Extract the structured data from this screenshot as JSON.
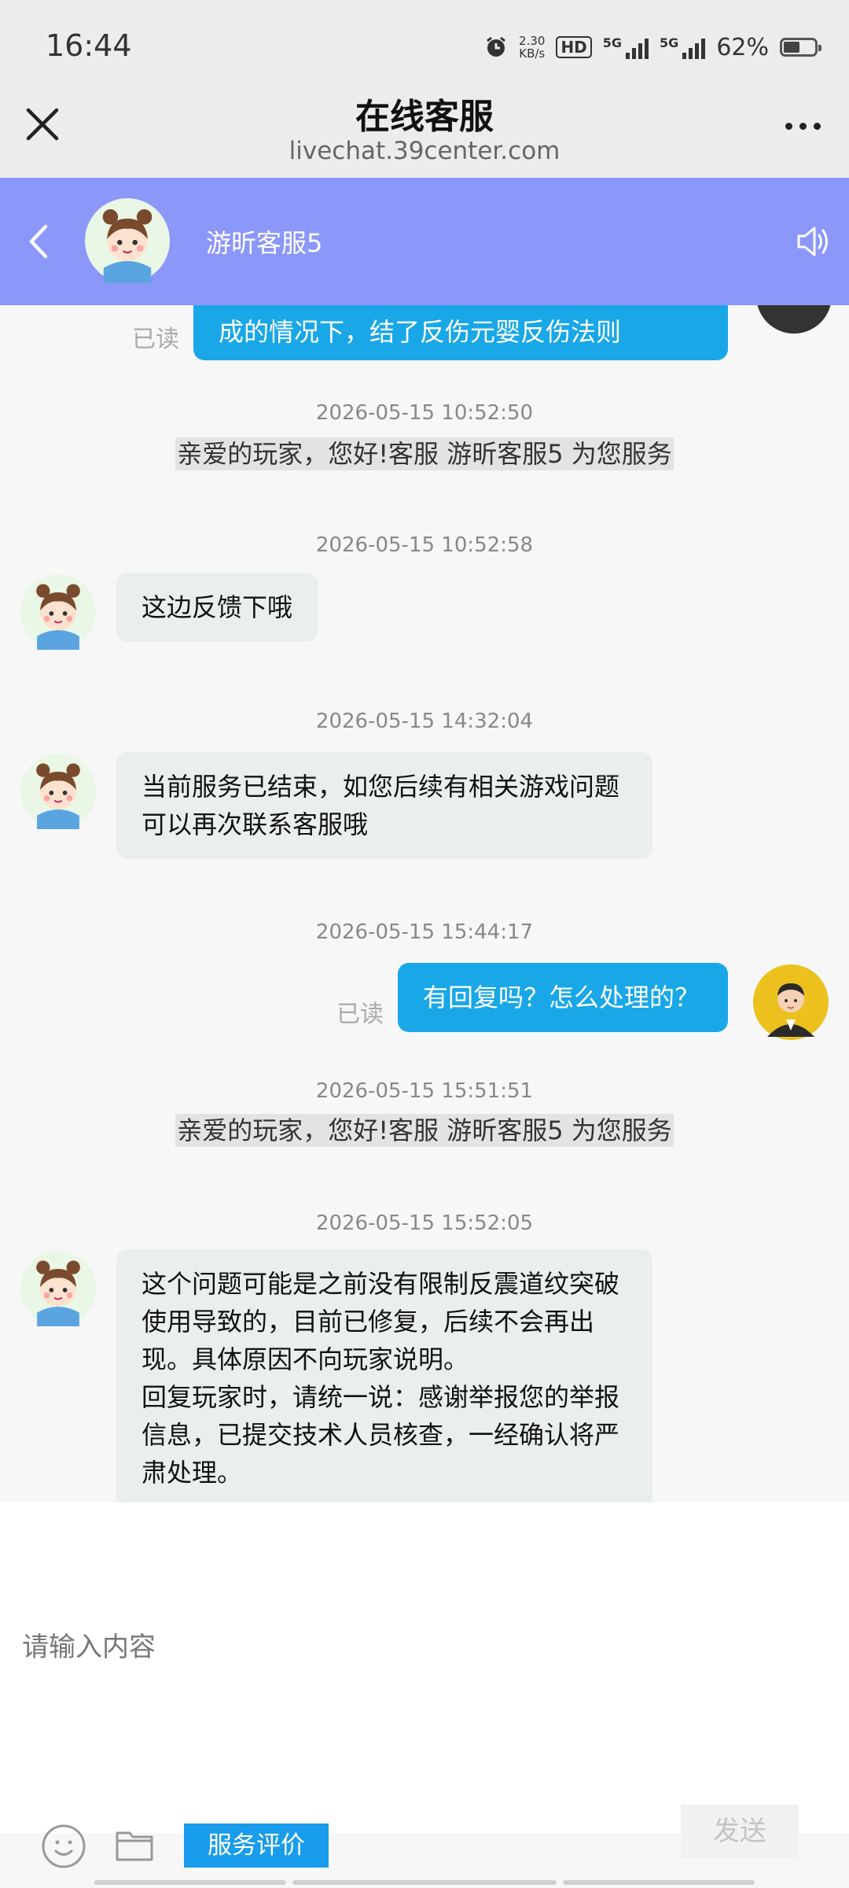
{
  "status_bar": {
    "time": "16:44",
    "net_speed_value": "2.30",
    "net_speed_unit": "KB/s",
    "hd": "HD",
    "signal1": "5G",
    "signal2": "5G",
    "battery": "62%"
  },
  "browser": {
    "title": "在线客服",
    "url": "livechat.39center.com"
  },
  "chat_header": {
    "agent_name": "游昕客服5"
  },
  "messages": {
    "top_partial": {
      "text": "成的情况下，结了反伤元婴反伤法则",
      "read": "已读"
    },
    "ts1": "2026-05-15 10:52:50",
    "notice1": "亲爱的玩家，您好!客服 游昕客服5 为您服务",
    "ts2": "2026-05-15 10:52:58",
    "msg2": "这边反馈下哦",
    "ts3": "2026-05-15 14:32:04",
    "msg3_line1": "当前服务已结束，如您后续有相关游戏问题",
    "msg3_line2": "可以再次联系客服哦",
    "ts4": "2026-05-15 15:44:17",
    "msg4": "有回复吗？怎么处理的？",
    "msg4_read": "已读",
    "ts5": "2026-05-15 15:51:51",
    "notice2": "亲爱的玩家，您好!客服 游昕客服5 为您服务",
    "ts6": "2026-05-15 15:52:05",
    "msg6_lines": [
      "这个问题可能是之前没有限制反震道纹突破",
      "使用导致的，目前已修复，后续不会再出",
      "现。具体原因不向玩家说明。",
      "回复玩家时，请统一说：感谢举报您的举报",
      "信息，已提交技术人员核查，一经确认将严",
      "肃处理。"
    ]
  },
  "input": {
    "placeholder": "请输入内容",
    "rate_label": "服务评价",
    "send_label": "发送"
  },
  "colors": {
    "header_bg": "#8c97fa",
    "bubble_out": "#19a7e8",
    "bubble_in": "#eaeeee",
    "rate_button": "#199ceb"
  }
}
